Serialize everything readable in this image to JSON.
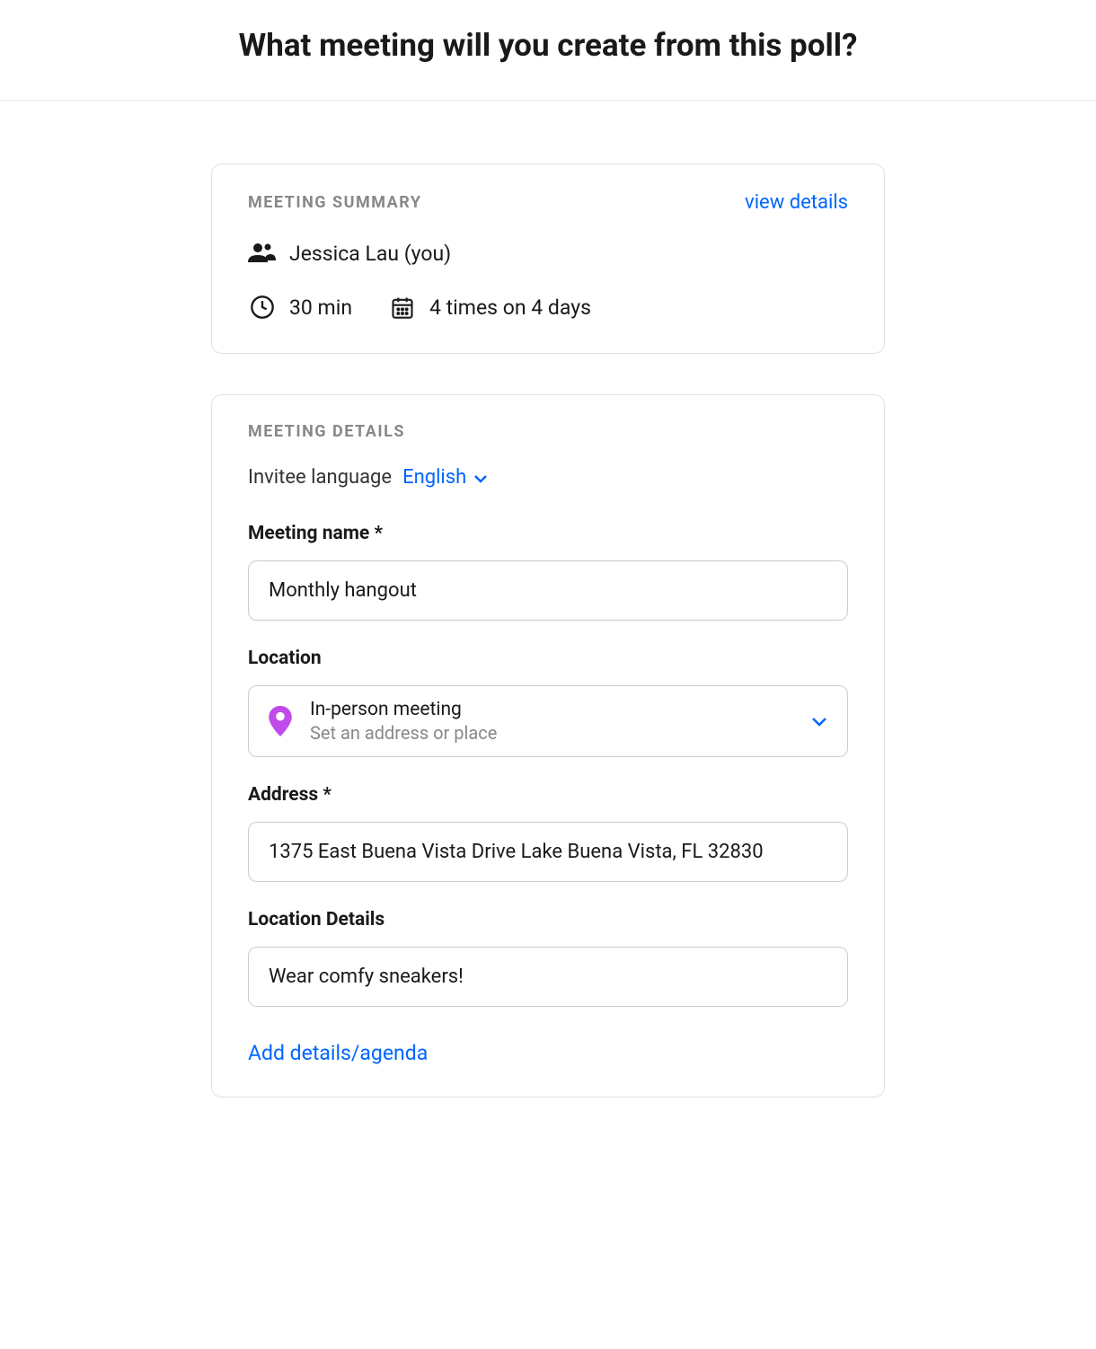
{
  "header": {
    "title": "What meeting will you create from this poll?"
  },
  "summary": {
    "section_label": "MEETING SUMMARY",
    "view_details": "view details",
    "organizer": "Jessica Lau (you)",
    "duration": "30 min",
    "times": "4 times on 4 days"
  },
  "details": {
    "section_label": "MEETING DETAILS",
    "language_label": "Invitee language",
    "language_value": "English",
    "meeting_name_label": "Meeting name *",
    "meeting_name_value": "Monthly hangout",
    "location_label": "Location",
    "location_type": "In-person meeting",
    "location_hint": "Set an address or place",
    "address_label": "Address *",
    "address_value": "1375 East Buena Vista Drive Lake Buena Vista, FL 32830",
    "location_details_label": "Location Details",
    "location_details_value": "Wear comfy sneakers!",
    "add_details_link": "Add details/agenda"
  }
}
